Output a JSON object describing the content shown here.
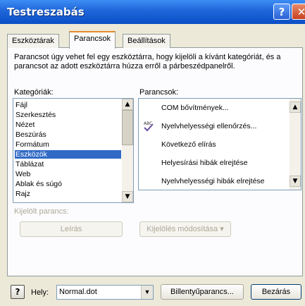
{
  "window": {
    "title": "Testreszabás",
    "help_glyph": "?",
    "close_glyph": "✕"
  },
  "tabs": [
    {
      "label": "Eszköztárak",
      "active": false
    },
    {
      "label": "Parancsok",
      "active": true
    },
    {
      "label": "Beállítások",
      "active": false
    }
  ],
  "description": "Parancsot úgy vehet fel egy eszköztárra, hogy kijelöli a kívánt kategóriát, és a parancsot az adott eszköztárra húzza erről a párbeszédpanelről.",
  "categories": {
    "label": "Kategóriák:",
    "items": [
      "Fájl",
      "Szerkesztés",
      "Nézet",
      "Beszúrás",
      "Formátum",
      "Eszközök",
      "Táblázat",
      "Web",
      "Ablak és súgó",
      "Rajz"
    ],
    "selected_index": 5,
    "scroll_up": "▲",
    "scroll_down": "▼"
  },
  "commands": {
    "label": "Parancsok:",
    "items": [
      {
        "text": "COM bővítmények...",
        "icon": ""
      },
      {
        "text": "Nyelvhelyességi ellenőrzés...",
        "icon": "spellcheck-icon"
      },
      {
        "text": "Következő elírás",
        "icon": ""
      },
      {
        "text": "Helyesírási hibák elrejtése",
        "icon": ""
      },
      {
        "text": "Nyelvhelyességi hibák elrejtése",
        "icon": ""
      }
    ],
    "scroll_up": "▲",
    "scroll_down": "▼"
  },
  "selected_command": {
    "label": "Kijelölt parancs:",
    "describe_button": "Leírás",
    "modify_button": "Kijelölés módosítása ▾"
  },
  "footer": {
    "help_button": "?",
    "save_in_label": "Hely:",
    "save_in_value": "Normal.dot",
    "dropdown_arrow": "▼",
    "keyboard_button": "Billentyűparancs...",
    "close_button": "Bezárás"
  },
  "colors": {
    "titlebar": "#0a4fc6",
    "selection": "#316ac5",
    "dialog_bg": "#ece9d8",
    "active_tab_accent": "#e68b2c"
  }
}
